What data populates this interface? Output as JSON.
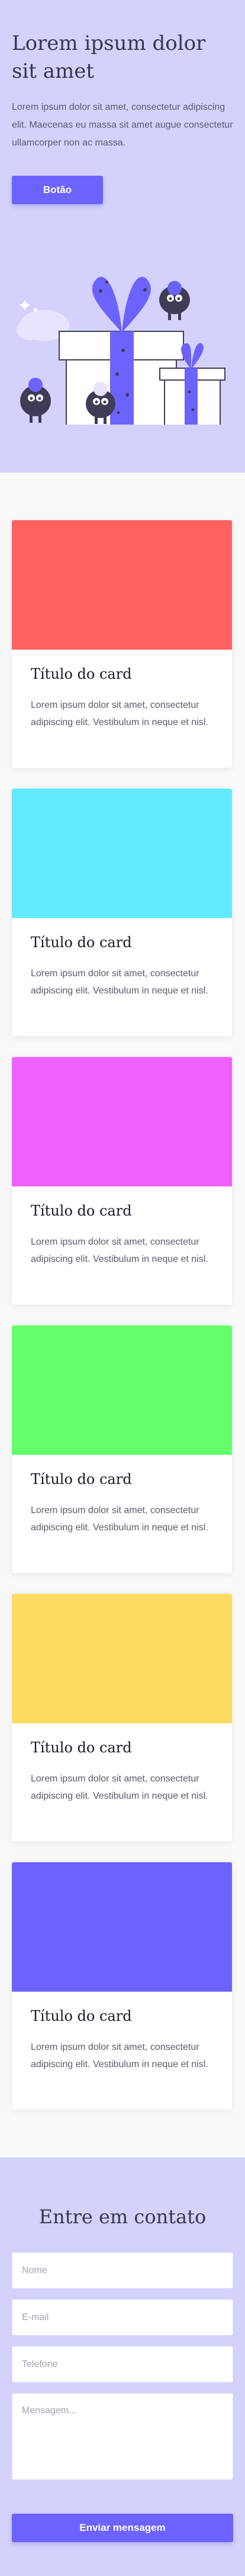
{
  "hero": {
    "title": "Lorem ipsum dolor sit amet",
    "text": "Lorem ipsum dolor sit amet, consectetur adipiscing elit. Maecenas eu massa sit amet augue consectetur ullamcorper non ac massa.",
    "button_label": "Botão",
    "illustration": "gift-boxes-with-monsters-illustration"
  },
  "colors": {
    "accent": "#6c63ff",
    "hero_background": "#d4d2fd",
    "page_background": "#f9f9f9"
  },
  "cards": [
    {
      "title": "Título do card",
      "text": "Lorem ipsum dolor sit amet, consectetur adipiscing elit. Vestibulum in neque et nisl.",
      "color": "#ff6161"
    },
    {
      "title": "Título do card",
      "text": "Lorem ipsum dolor sit amet, consectetur adipiscing elit. Vestibulum in neque et nisl.",
      "color": "#61eaff"
    },
    {
      "title": "Título do card",
      "text": "Lorem ipsum dolor sit amet, consectetur adipiscing elit. Vestibulum in neque et nisl.",
      "color": "#f061ff"
    },
    {
      "title": "Título do card",
      "text": "Lorem ipsum dolor sit amet, consectetur adipiscing elit. Vestibulum in neque et nisl.",
      "color": "#66ff6c"
    },
    {
      "title": "Título do card",
      "text": "Lorem ipsum dolor sit amet, consectetur adipiscing elit. Vestibulum in neque et nisl.",
      "color": "#ffdb61"
    },
    {
      "title": "Título do card",
      "text": "Lorem ipsum dolor sit amet, consectetur adipiscing elit. Vestibulum in neque et nisl.",
      "color": "#6c63ff"
    }
  ],
  "contact": {
    "title": "Entre em contato",
    "name_placeholder": "Nome",
    "email_placeholder": "E-mail",
    "phone_placeholder": "Telefone",
    "message_placeholder": "Mensagem...",
    "submit_label": "Enviar mensagem"
  }
}
